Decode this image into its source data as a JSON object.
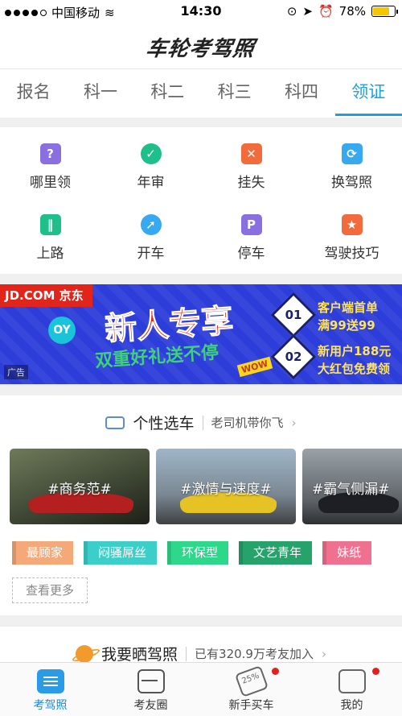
{
  "status_bar": {
    "carrier": "中国移动",
    "time": "14:30",
    "battery": "78%",
    "battery_level": 0.78
  },
  "app": {
    "title": "车轮考驾照"
  },
  "tabs": [
    {
      "label": "报名",
      "active": false
    },
    {
      "label": "科一",
      "active": false
    },
    {
      "label": "科二",
      "active": false
    },
    {
      "label": "科三",
      "active": false
    },
    {
      "label": "科四",
      "active": false
    },
    {
      "label": "领证",
      "active": true
    }
  ],
  "grid": [
    {
      "label": "哪里领",
      "icon": "question-icon",
      "glyph": "?",
      "color": "#8a6fe0"
    },
    {
      "label": "年审",
      "icon": "check-icon",
      "glyph": "✓",
      "color": "#1fbf8a"
    },
    {
      "label": "挂失",
      "icon": "loss-icon",
      "glyph": "✕",
      "color": "#f26b3c"
    },
    {
      "label": "换驾照",
      "icon": "refresh-icon",
      "glyph": "⟳",
      "color": "#36a9f0"
    },
    {
      "label": "上路",
      "icon": "road-icon",
      "glyph": "‖",
      "color": "#1fbf8a"
    },
    {
      "label": "开车",
      "icon": "compass-icon",
      "glyph": "➚",
      "color": "#36a9f0"
    },
    {
      "label": "停车",
      "icon": "parking-icon",
      "glyph": "P",
      "color": "#8a6fe0"
    },
    {
      "label": "驾驶技巧",
      "icon": "star-icon",
      "glyph": "★",
      "color": "#f26b3c"
    }
  ],
  "ad": {
    "brand": "JD.COM 京东",
    "headline": "新人专享",
    "subline": "双重好礼送不停",
    "oy": "OY",
    "wow": "WOW",
    "offers": [
      {
        "num": "01",
        "line1": "客户端首单",
        "line2": "满99送99"
      },
      {
        "num": "02",
        "line1": "新用户188元",
        "line2": "大红包免费领"
      }
    ],
    "tag": "广告"
  },
  "personality": {
    "title": "个性选车",
    "subtitle": "老司机带你飞",
    "cars": [
      {
        "label": "#商务范#"
      },
      {
        "label": "#激情与速度#"
      },
      {
        "label": "#霸气侧漏#"
      }
    ],
    "chips": [
      {
        "label": "最顾家",
        "color": "#f5a878"
      },
      {
        "label": "闷骚屌丝",
        "color": "#3ccfc9"
      },
      {
        "label": "环保型",
        "color": "#2ed88a"
      },
      {
        "label": "文艺青年",
        "color": "#26a36a"
      },
      {
        "label": "妹纸",
        "color": "#f0708f"
      }
    ],
    "more": "查看更多"
  },
  "show_license": {
    "title": "我要晒驾照",
    "subtitle": "已有320.9万考友加入"
  },
  "bottom_nav": [
    {
      "label": "考驾照",
      "active": true,
      "icon": "license-icon",
      "badge": false
    },
    {
      "label": "考友圈",
      "active": false,
      "icon": "steering-wheel-icon",
      "badge": false
    },
    {
      "label": "新手买车",
      "active": false,
      "icon": "discount-tag-icon",
      "badge": true,
      "tag_text": "25%"
    },
    {
      "label": "我的",
      "active": false,
      "icon": "user-icon",
      "badge": true
    }
  ]
}
